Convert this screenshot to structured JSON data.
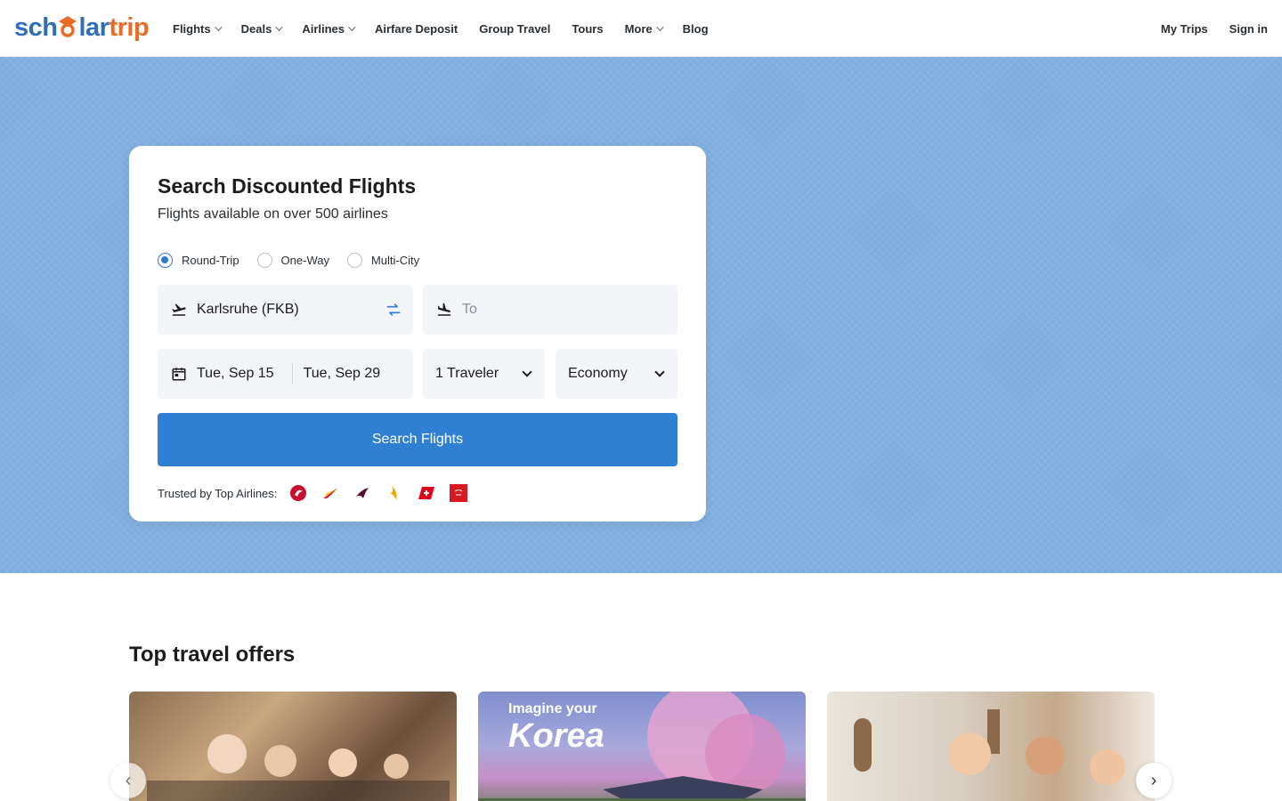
{
  "brand": {
    "logo_part1": "sch",
    "logo_part2": "lar",
    "logo_part3": "trip"
  },
  "nav": {
    "items": [
      {
        "label": "Flights",
        "dropdown": true
      },
      {
        "label": "Deals",
        "dropdown": true
      },
      {
        "label": "Airlines",
        "dropdown": true
      },
      {
        "label": "Airfare Deposit",
        "dropdown": false
      },
      {
        "label": "Group Travel",
        "dropdown": false
      },
      {
        "label": "Tours",
        "dropdown": false
      },
      {
        "label": "More",
        "dropdown": true
      },
      {
        "label": "Blog",
        "dropdown": false
      }
    ],
    "my_trips": "My Trips",
    "sign_in": "Sign in"
  },
  "search": {
    "title": "Search Discounted Flights",
    "subtitle": "Flights available on over 500 airlines",
    "trip_types": [
      {
        "label": "Round-Trip",
        "checked": true
      },
      {
        "label": "One-Way",
        "checked": false
      },
      {
        "label": "Multi-City",
        "checked": false
      }
    ],
    "from_value": "Karlsruhe (FKB)",
    "to_placeholder": "To",
    "depart_date": "Tue, Sep 15",
    "return_date": "Tue, Sep 29",
    "travelers": "1 Traveler",
    "cabin": "Economy",
    "button": "Search Flights",
    "trusted_label": "Trusted by Top Airlines:",
    "airlines": [
      "turkish-airlines-logo",
      "iberia-logo",
      "qatar-airways-logo",
      "singapore-airlines-logo",
      "swiss-logo",
      "emirates-logo"
    ]
  },
  "offers": {
    "title": "Top travel offers",
    "items": [
      {
        "caption": ""
      },
      {
        "caption_small": "Imagine your",
        "caption_big": "Korea"
      },
      {
        "caption": ""
      }
    ]
  },
  "colors": {
    "primary": "#2f80d3",
    "hero_bg": "#7fadde",
    "logo_blue": "#2f6fb8",
    "logo_orange": "#ec6b23"
  }
}
